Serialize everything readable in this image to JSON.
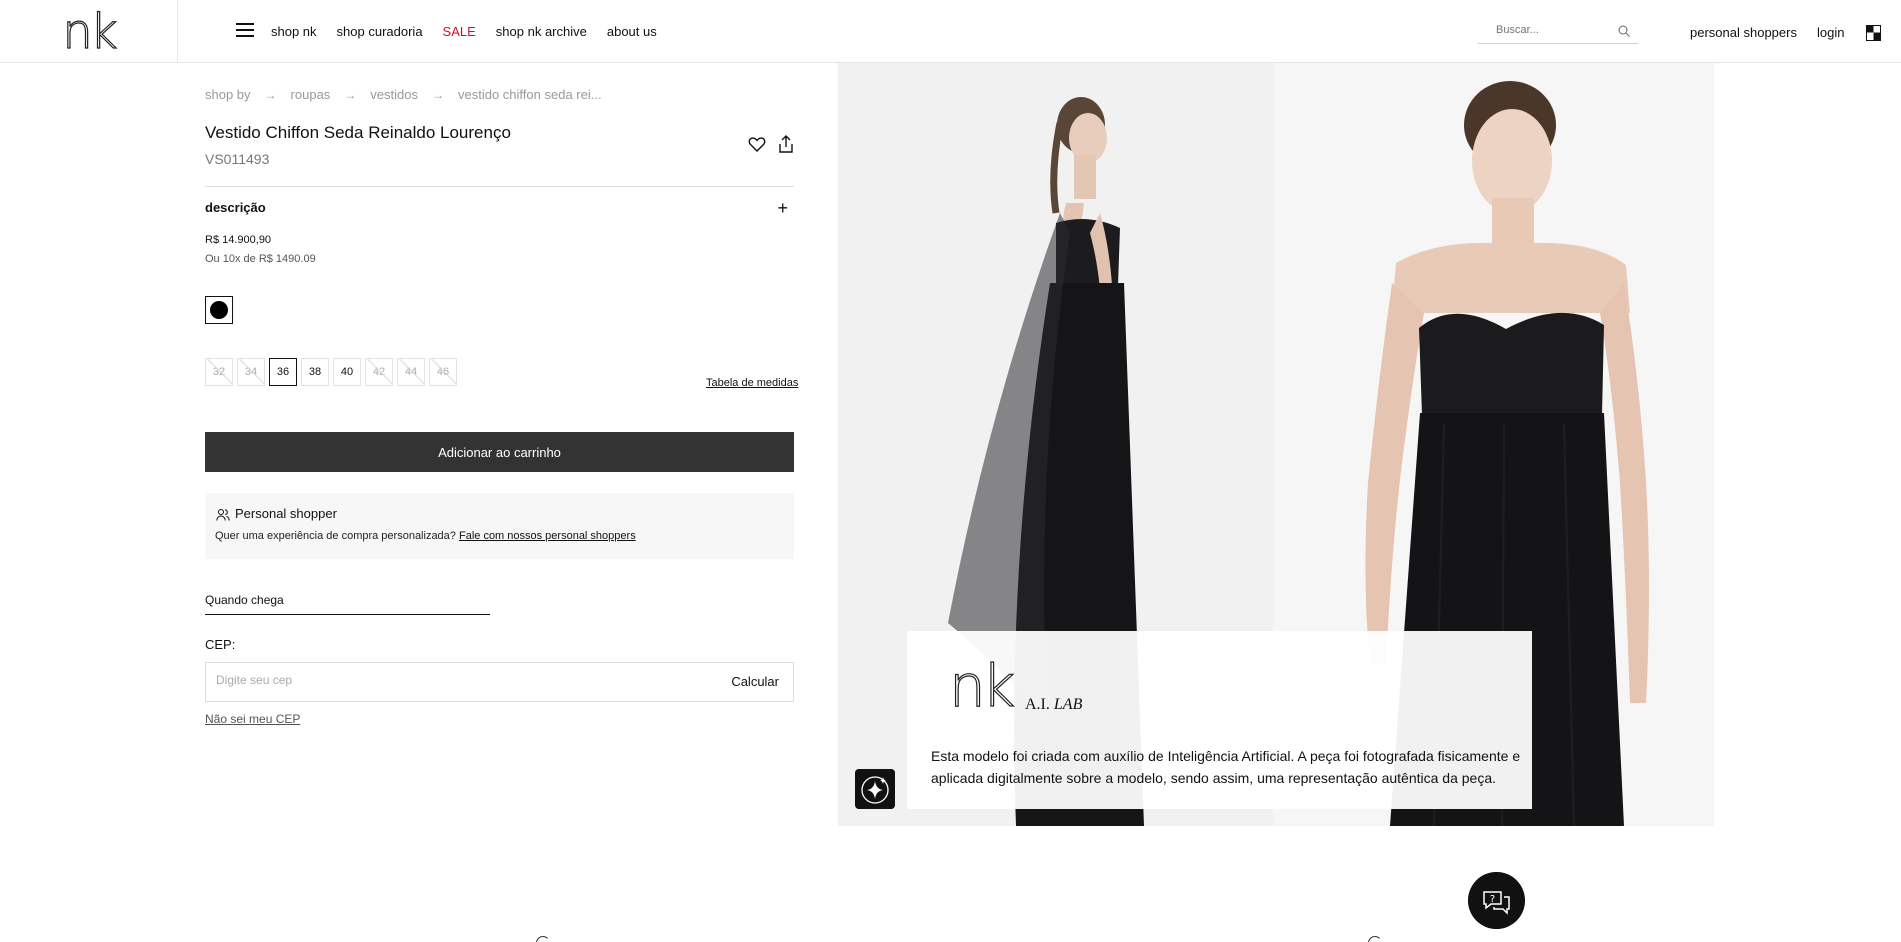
{
  "header": {
    "logo": "nk",
    "nav": [
      {
        "label": "shop nk"
      },
      {
        "label": "shop curadoria"
      },
      {
        "label": "SALE"
      },
      {
        "label": "shop nk archive"
      },
      {
        "label": "about us"
      }
    ],
    "search_placeholder": "Buscar...",
    "personal_shoppers": "personal shoppers",
    "login": "login"
  },
  "breadcrumb": [
    "shop by",
    "roupas",
    "vestidos",
    "vestido chiffon seda rei..."
  ],
  "product": {
    "title": "Vestido Chiffon Seda Reinaldo Lourenço",
    "sku": "VS011493",
    "description_label": "descrição",
    "price": "R$ 14.900,90",
    "installments": "Ou 10x de R$ 1490.09",
    "color": "#000000",
    "sizes": [
      {
        "label": "32",
        "available": false
      },
      {
        "label": "34",
        "available": false
      },
      {
        "label": "36",
        "available": true,
        "selected": true
      },
      {
        "label": "38",
        "available": true
      },
      {
        "label": "40",
        "available": true
      },
      {
        "label": "42",
        "available": false
      },
      {
        "label": "44",
        "available": false
      },
      {
        "label": "46",
        "available": false
      }
    ],
    "size_chart": "Tabela de medidas",
    "add_to_cart": "Adicionar ao carrinho"
  },
  "personal_shopper": {
    "title": "Personal shopper",
    "text": "Quer uma experiência de compra personalizada?",
    "link": "Fale com nossos personal shoppers"
  },
  "shipping": {
    "title": "Quando chega",
    "cep_label": "CEP:",
    "cep_placeholder": "Digite seu cep",
    "calc": "Calcular",
    "dont_know": "Não sei meu CEP"
  },
  "ai_card": {
    "logo": "nk",
    "lab_prefix": "A.I.",
    "lab_suffix": "LAB",
    "text": "Esta modelo foi criada com auxílio de Inteligência Artificial. A peça foi fotografada fisicamente e aplicada digitalmente sobre a modelo, sendo assim, uma representação autêntica da peça."
  }
}
